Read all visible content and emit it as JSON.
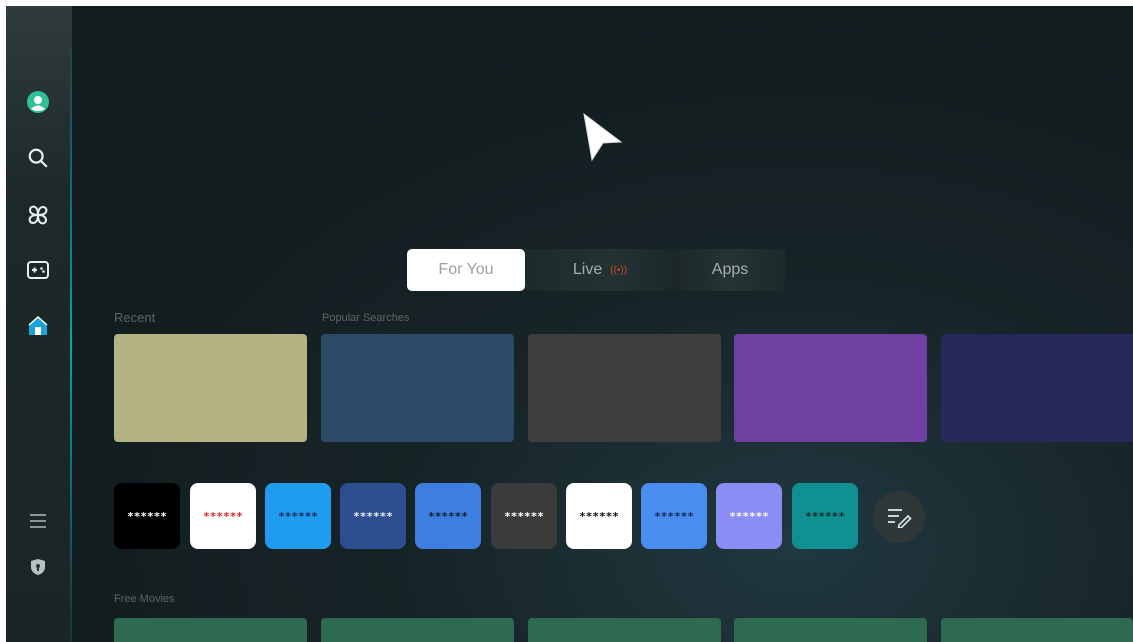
{
  "sidebar": {
    "items": [
      {
        "name": "profile",
        "icon": "profile-icon"
      },
      {
        "name": "search",
        "icon": "search-icon"
      },
      {
        "name": "ambient",
        "icon": "clover-icon"
      },
      {
        "name": "gaming",
        "icon": "game-pad-icon"
      },
      {
        "name": "home",
        "icon": "home-icon",
        "active": true
      },
      {
        "name": "menu",
        "icon": "menu-icon"
      },
      {
        "name": "privacy",
        "icon": "shield-icon"
      }
    ],
    "accent_color": "#1aa3d9"
  },
  "tabs": {
    "for_you": "For You",
    "live": "Live",
    "live_icon": "(̧̧•̧)",
    "apps": "Apps"
  },
  "sections": {
    "recent": "Recent",
    "popular": "Popular Searches",
    "free_movies": "Free Movies"
  },
  "cards": [
    {
      "color": "#b5b283"
    },
    {
      "color": "#2a4a66"
    },
    {
      "color": "#3e3e3e"
    },
    {
      "color": "#6f3fa1"
    },
    {
      "color": "#28285a"
    }
  ],
  "apps": [
    {
      "label": "******",
      "bg": "#000000",
      "fg": "#ffffff"
    },
    {
      "label": "******",
      "bg": "#ffffff",
      "fg": "#e0262c"
    },
    {
      "label": "******",
      "bg": "#1f9cf0",
      "fg": "#102a55"
    },
    {
      "label": "******",
      "bg": "#2d4f8f",
      "fg": "#e8eef8"
    },
    {
      "label": "******",
      "bg": "#3d7fe0",
      "fg": "#0f1e33"
    },
    {
      "label": "******",
      "bg": "#3b3b3b",
      "fg": "#ffffff"
    },
    {
      "label": "******",
      "bg": "#ffffff",
      "fg": "#111111"
    },
    {
      "label": "******",
      "bg": "#4a8df0",
      "fg": "#0f2a55"
    },
    {
      "label": "******",
      "bg": "#8c8cf5",
      "fg": "#ffffff"
    },
    {
      "label": "******",
      "bg": "#109090",
      "fg": "#0d2a2a"
    }
  ],
  "edit_icon": "edit-list-icon"
}
